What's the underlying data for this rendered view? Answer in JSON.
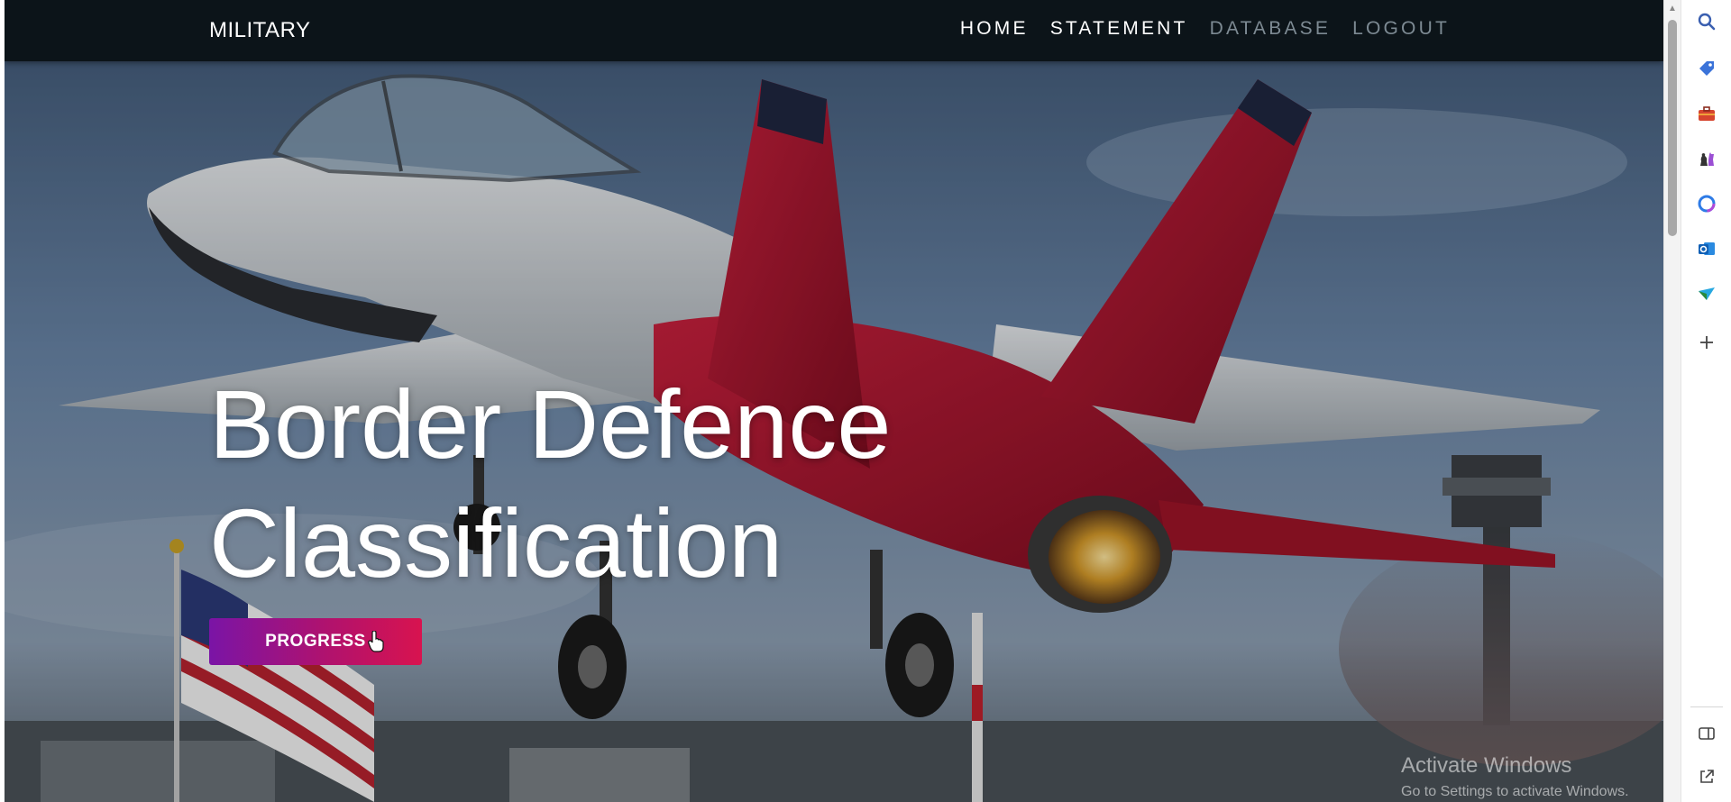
{
  "navbar": {
    "brand": "MILITARY",
    "links": [
      {
        "label": "HOME",
        "state": "active"
      },
      {
        "label": "STATEMENT",
        "state": "active"
      },
      {
        "label": "DATABASE",
        "state": "muted"
      },
      {
        "label": "LOGOUT",
        "state": "muted"
      }
    ]
  },
  "hero": {
    "title_line1": "Border Defence",
    "title_line2": "Classification",
    "cta_label": "PROGRESS",
    "cta_gradient": [
      "#7a14a6",
      "#d8134f"
    ]
  },
  "watermark": {
    "title": "Activate Windows",
    "subtitle": "Go to Settings to activate Windows."
  },
  "sidepanel": {
    "icons": [
      "search-icon",
      "tag-icon",
      "briefcase-icon",
      "chess-icon",
      "copilot-icon",
      "outlook-icon",
      "send-icon",
      "add-icon",
      "sidebar-toggle-icon",
      "external-link-icon"
    ]
  },
  "colors": {
    "navbar_bg": "#0c1419",
    "nav_active": "#ffffff",
    "nav_muted": "#7d8a93",
    "plane_red": "#b3122e"
  }
}
